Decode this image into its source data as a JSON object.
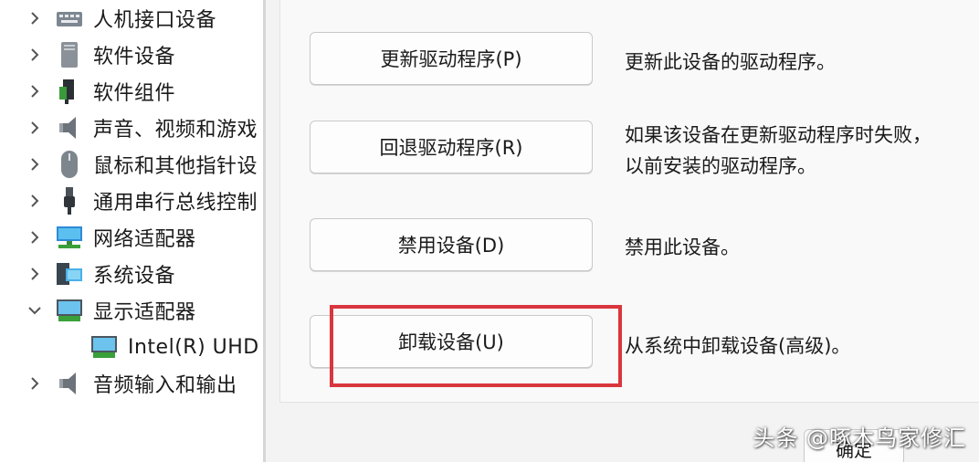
{
  "tree": {
    "items": [
      {
        "label": "人机接口设备",
        "icon": "hid-icon",
        "expanded": false
      },
      {
        "label": "软件设备",
        "icon": "software-device-icon",
        "expanded": false
      },
      {
        "label": "软件组件",
        "icon": "software-component-icon",
        "expanded": false
      },
      {
        "label": "声音、视频和游戏",
        "icon": "speaker-icon",
        "expanded": false
      },
      {
        "label": "鼠标和其他指针设",
        "icon": "mouse-icon",
        "expanded": false
      },
      {
        "label": "通用串行总线控制",
        "icon": "usb-icon",
        "expanded": false
      },
      {
        "label": "网络适配器",
        "icon": "network-adapter-icon",
        "expanded": false
      },
      {
        "label": "系统设备",
        "icon": "system-device-icon",
        "expanded": false
      },
      {
        "label": "显示适配器",
        "icon": "display-adapter-icon",
        "expanded": true
      },
      {
        "label": "Intel(R) UHD",
        "icon": "display-adapter-icon",
        "child": true
      },
      {
        "label": "音频输入和输出",
        "icon": "speaker-icon",
        "expanded": false
      }
    ]
  },
  "actions": {
    "update": {
      "button": "更新驱动程序(P)",
      "description": "更新此设备的驱动程序。"
    },
    "rollback": {
      "button": "回退驱动程序(R)",
      "description_line1": "如果该设备在更新驱动程序时失败，",
      "description_line2": "以前安装的驱动程序。"
    },
    "disable": {
      "button": "禁用设备(D)",
      "description": "禁用此设备。"
    },
    "uninstall": {
      "button": "卸载设备(U)",
      "description": "从系统中卸载设备(高级)。"
    }
  },
  "footer": {
    "ok_label": "确定"
  },
  "watermark": {
    "text": "头条 @啄木鸟家修汇"
  },
  "colors": {
    "highlight": "#d9363e",
    "panel": "#f9f9f9",
    "button_border": "#c9c9c9"
  }
}
